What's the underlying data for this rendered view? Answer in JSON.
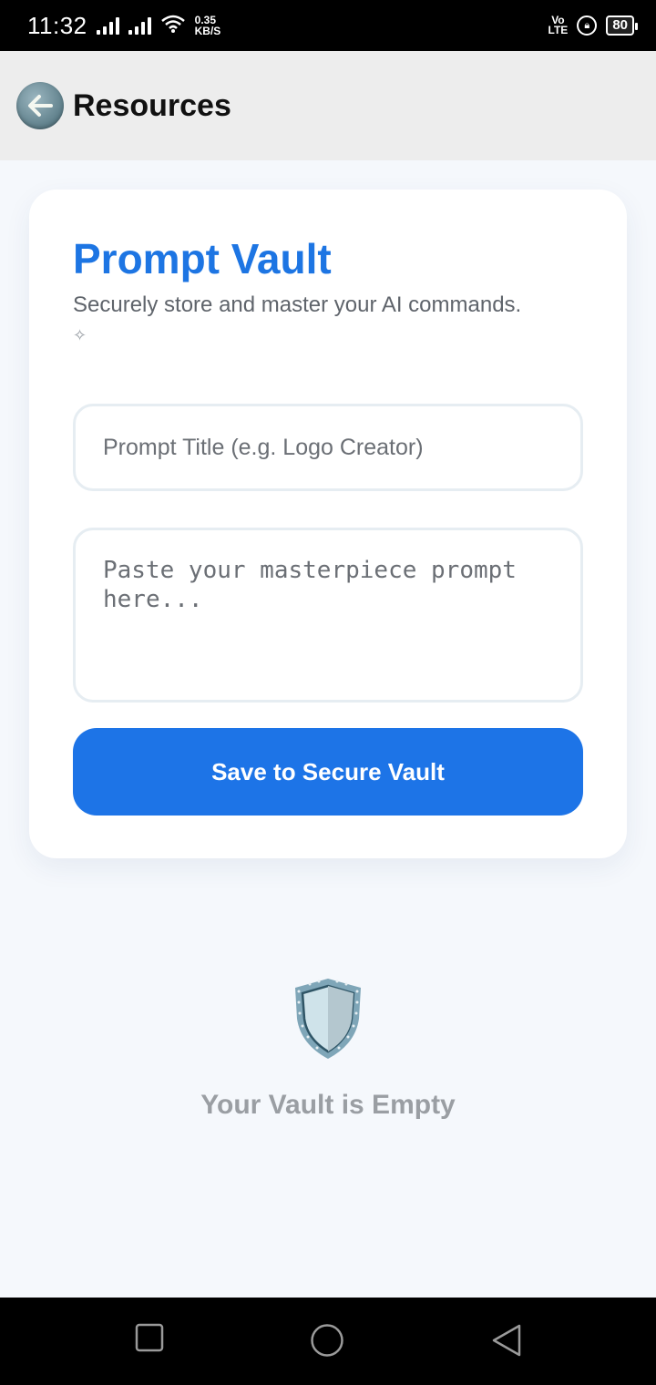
{
  "status_bar": {
    "time": "11:32",
    "speed_value": "0.35",
    "speed_unit": "KB/S",
    "volte_top": "Vo",
    "volte_bottom": "LTE",
    "battery": "80"
  },
  "app_bar": {
    "title": "Resources",
    "back_icon": "arrow-left-icon"
  },
  "card": {
    "title": "Prompt Vault",
    "subtitle": "Securely store and master your AI commands.",
    "sparkle": "✧",
    "title_input": {
      "placeholder": "Prompt Title (e.g. Logo Creator)",
      "value": ""
    },
    "prompt_input": {
      "placeholder": "Paste your masterpiece prompt here...",
      "value": ""
    },
    "save_label": "Save to Secure Vault"
  },
  "empty_state": {
    "icon": "shield-icon",
    "text": "Your Vault is Empty"
  },
  "colors": {
    "accent": "#1d74e7",
    "title_blue": "#1d75e3",
    "page_background": "#f5f8fc",
    "app_bar_background": "#ededed",
    "empty_text": "#9a9ea3"
  },
  "nav_bar": {
    "recent_icon": "square-icon",
    "home_icon": "circle-icon",
    "back_icon": "triangle-back-icon"
  }
}
